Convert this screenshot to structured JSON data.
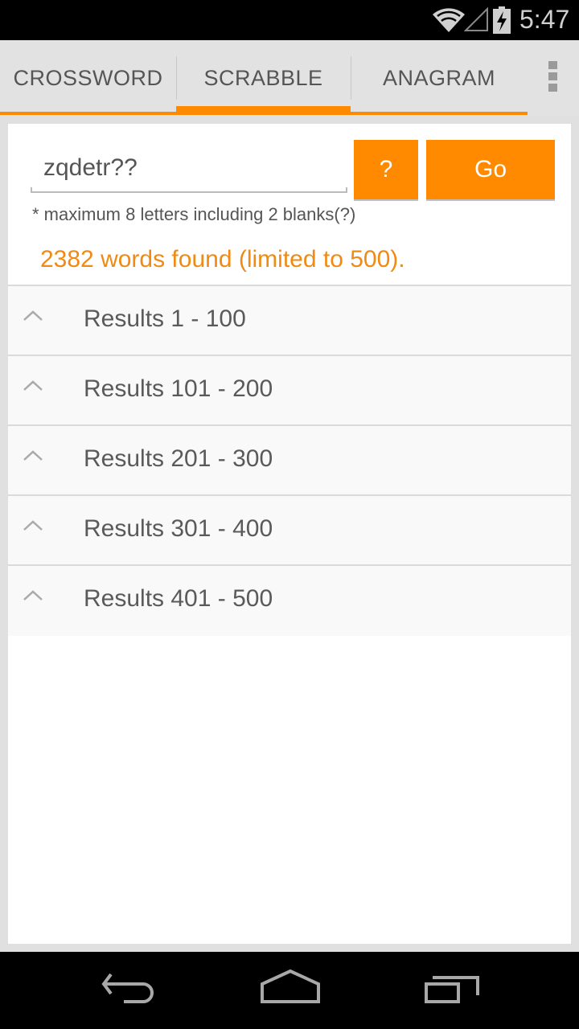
{
  "status_bar": {
    "time": "5:47",
    "icons": [
      "wifi-icon",
      "cell-signal-icon",
      "battery-charging-icon"
    ]
  },
  "tabs": [
    {
      "label": "CROSSWORD",
      "active": false
    },
    {
      "label": "SCRABBLE",
      "active": true
    },
    {
      "label": "ANAGRAM",
      "active": false
    }
  ],
  "overflow_menu_icon": "overflow-menu-icon",
  "search": {
    "value": "zqdetr??",
    "placeholder": "",
    "help_label": "?",
    "go_label": "Go",
    "hint": "* maximum 8 letters including 2 blanks(?)"
  },
  "result_summary": "2382 words found (limited to 500).",
  "result_groups": [
    {
      "label": "Results 1 - 100",
      "icon": "chevron-up-icon"
    },
    {
      "label": "Results 101 - 200",
      "icon": "chevron-up-icon"
    },
    {
      "label": "Results 201 - 300",
      "icon": "chevron-up-icon"
    },
    {
      "label": "Results 301 - 400",
      "icon": "chevron-up-icon"
    },
    {
      "label": "Results 401 - 500",
      "icon": "chevron-up-icon"
    }
  ],
  "nav_bar": {
    "buttons": [
      "back",
      "home",
      "recent-apps"
    ]
  },
  "colors": {
    "accent": "#ff8a00",
    "summary_text": "#f08a12",
    "tab_bar_bg": "#e2e2e2",
    "row_bg": "#f9f9f9"
  }
}
